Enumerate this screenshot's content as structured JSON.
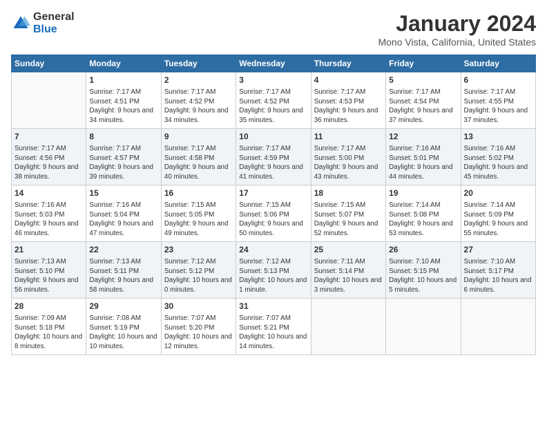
{
  "logo": {
    "general": "General",
    "blue": "Blue"
  },
  "title": "January 2024",
  "location": "Mono Vista, California, United States",
  "weekdays": [
    "Sunday",
    "Monday",
    "Tuesday",
    "Wednesday",
    "Thursday",
    "Friday",
    "Saturday"
  ],
  "weeks": [
    [
      {
        "day": "",
        "sunrise": "",
        "sunset": "",
        "daylight": ""
      },
      {
        "day": "1",
        "sunrise": "Sunrise: 7:17 AM",
        "sunset": "Sunset: 4:51 PM",
        "daylight": "Daylight: 9 hours and 34 minutes."
      },
      {
        "day": "2",
        "sunrise": "Sunrise: 7:17 AM",
        "sunset": "Sunset: 4:52 PM",
        "daylight": "Daylight: 9 hours and 34 minutes."
      },
      {
        "day": "3",
        "sunrise": "Sunrise: 7:17 AM",
        "sunset": "Sunset: 4:52 PM",
        "daylight": "Daylight: 9 hours and 35 minutes."
      },
      {
        "day": "4",
        "sunrise": "Sunrise: 7:17 AM",
        "sunset": "Sunset: 4:53 PM",
        "daylight": "Daylight: 9 hours and 36 minutes."
      },
      {
        "day": "5",
        "sunrise": "Sunrise: 7:17 AM",
        "sunset": "Sunset: 4:54 PM",
        "daylight": "Daylight: 9 hours and 37 minutes."
      },
      {
        "day": "6",
        "sunrise": "Sunrise: 7:17 AM",
        "sunset": "Sunset: 4:55 PM",
        "daylight": "Daylight: 9 hours and 37 minutes."
      }
    ],
    [
      {
        "day": "7",
        "sunrise": "Sunrise: 7:17 AM",
        "sunset": "Sunset: 4:56 PM",
        "daylight": "Daylight: 9 hours and 38 minutes."
      },
      {
        "day": "8",
        "sunrise": "Sunrise: 7:17 AM",
        "sunset": "Sunset: 4:57 PM",
        "daylight": "Daylight: 9 hours and 39 minutes."
      },
      {
        "day": "9",
        "sunrise": "Sunrise: 7:17 AM",
        "sunset": "Sunset: 4:58 PM",
        "daylight": "Daylight: 9 hours and 40 minutes."
      },
      {
        "day": "10",
        "sunrise": "Sunrise: 7:17 AM",
        "sunset": "Sunset: 4:59 PM",
        "daylight": "Daylight: 9 hours and 41 minutes."
      },
      {
        "day": "11",
        "sunrise": "Sunrise: 7:17 AM",
        "sunset": "Sunset: 5:00 PM",
        "daylight": "Daylight: 9 hours and 43 minutes."
      },
      {
        "day": "12",
        "sunrise": "Sunrise: 7:16 AM",
        "sunset": "Sunset: 5:01 PM",
        "daylight": "Daylight: 9 hours and 44 minutes."
      },
      {
        "day": "13",
        "sunrise": "Sunrise: 7:16 AM",
        "sunset": "Sunset: 5:02 PM",
        "daylight": "Daylight: 9 hours and 45 minutes."
      }
    ],
    [
      {
        "day": "14",
        "sunrise": "Sunrise: 7:16 AM",
        "sunset": "Sunset: 5:03 PM",
        "daylight": "Daylight: 9 hours and 46 minutes."
      },
      {
        "day": "15",
        "sunrise": "Sunrise: 7:16 AM",
        "sunset": "Sunset: 5:04 PM",
        "daylight": "Daylight: 9 hours and 47 minutes."
      },
      {
        "day": "16",
        "sunrise": "Sunrise: 7:15 AM",
        "sunset": "Sunset: 5:05 PM",
        "daylight": "Daylight: 9 hours and 49 minutes."
      },
      {
        "day": "17",
        "sunrise": "Sunrise: 7:15 AM",
        "sunset": "Sunset: 5:06 PM",
        "daylight": "Daylight: 9 hours and 50 minutes."
      },
      {
        "day": "18",
        "sunrise": "Sunrise: 7:15 AM",
        "sunset": "Sunset: 5:07 PM",
        "daylight": "Daylight: 9 hours and 52 minutes."
      },
      {
        "day": "19",
        "sunrise": "Sunrise: 7:14 AM",
        "sunset": "Sunset: 5:08 PM",
        "daylight": "Daylight: 9 hours and 53 minutes."
      },
      {
        "day": "20",
        "sunrise": "Sunrise: 7:14 AM",
        "sunset": "Sunset: 5:09 PM",
        "daylight": "Daylight: 9 hours and 55 minutes."
      }
    ],
    [
      {
        "day": "21",
        "sunrise": "Sunrise: 7:13 AM",
        "sunset": "Sunset: 5:10 PM",
        "daylight": "Daylight: 9 hours and 56 minutes."
      },
      {
        "day": "22",
        "sunrise": "Sunrise: 7:13 AM",
        "sunset": "Sunset: 5:11 PM",
        "daylight": "Daylight: 9 hours and 58 minutes."
      },
      {
        "day": "23",
        "sunrise": "Sunrise: 7:12 AM",
        "sunset": "Sunset: 5:12 PM",
        "daylight": "Daylight: 10 hours and 0 minutes."
      },
      {
        "day": "24",
        "sunrise": "Sunrise: 7:12 AM",
        "sunset": "Sunset: 5:13 PM",
        "daylight": "Daylight: 10 hours and 1 minute."
      },
      {
        "day": "25",
        "sunrise": "Sunrise: 7:11 AM",
        "sunset": "Sunset: 5:14 PM",
        "daylight": "Daylight: 10 hours and 3 minutes."
      },
      {
        "day": "26",
        "sunrise": "Sunrise: 7:10 AM",
        "sunset": "Sunset: 5:15 PM",
        "daylight": "Daylight: 10 hours and 5 minutes."
      },
      {
        "day": "27",
        "sunrise": "Sunrise: 7:10 AM",
        "sunset": "Sunset: 5:17 PM",
        "daylight": "Daylight: 10 hours and 6 minutes."
      }
    ],
    [
      {
        "day": "28",
        "sunrise": "Sunrise: 7:09 AM",
        "sunset": "Sunset: 5:18 PM",
        "daylight": "Daylight: 10 hours and 8 minutes."
      },
      {
        "day": "29",
        "sunrise": "Sunrise: 7:08 AM",
        "sunset": "Sunset: 5:19 PM",
        "daylight": "Daylight: 10 hours and 10 minutes."
      },
      {
        "day": "30",
        "sunrise": "Sunrise: 7:07 AM",
        "sunset": "Sunset: 5:20 PM",
        "daylight": "Daylight: 10 hours and 12 minutes."
      },
      {
        "day": "31",
        "sunrise": "Sunrise: 7:07 AM",
        "sunset": "Sunset: 5:21 PM",
        "daylight": "Daylight: 10 hours and 14 minutes."
      },
      {
        "day": "",
        "sunrise": "",
        "sunset": "",
        "daylight": ""
      },
      {
        "day": "",
        "sunrise": "",
        "sunset": "",
        "daylight": ""
      },
      {
        "day": "",
        "sunrise": "",
        "sunset": "",
        "daylight": ""
      }
    ]
  ]
}
